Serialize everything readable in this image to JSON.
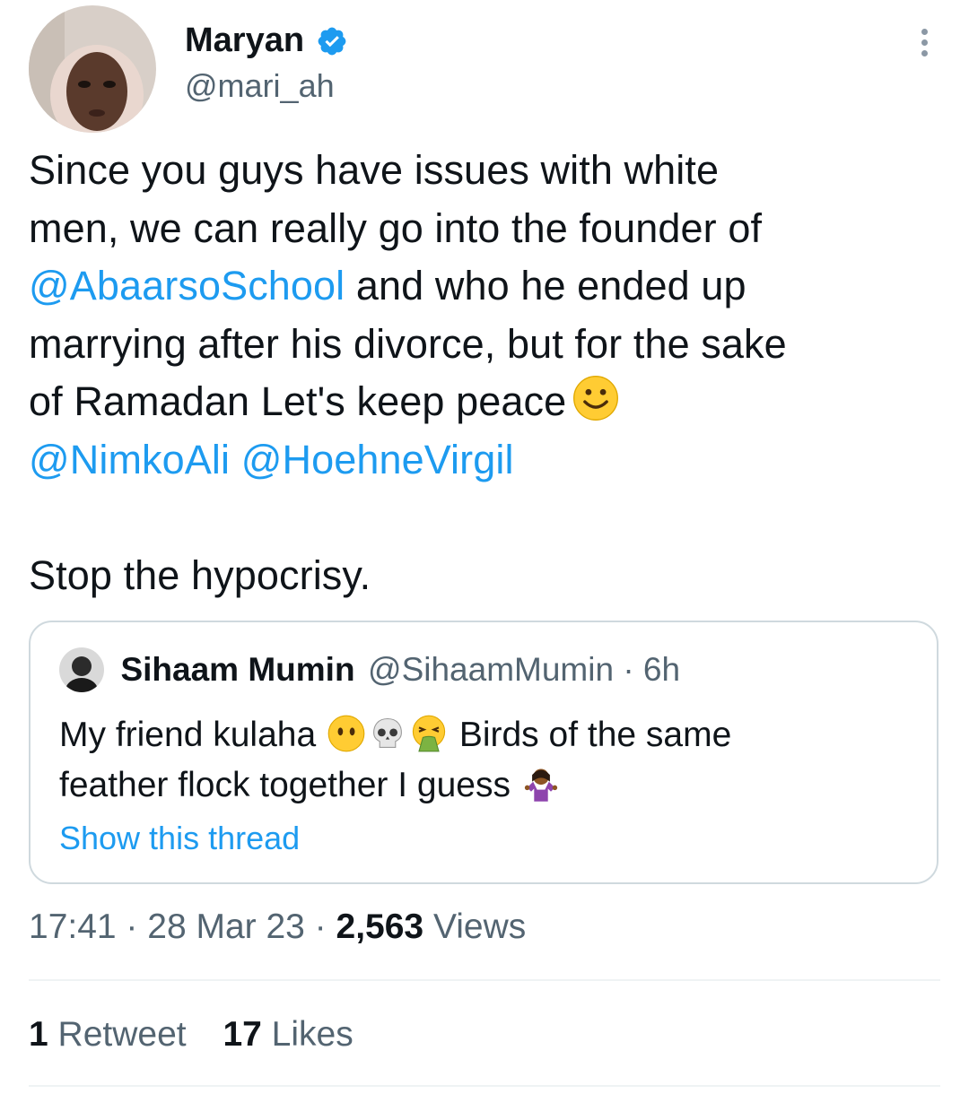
{
  "author": {
    "display_name": "Maryan",
    "handle": "@mari_ah",
    "verified": true,
    "avatar": "profile-photo"
  },
  "tweet": {
    "line1": "Since you guys have issues with white",
    "line2": "men, we can really go into the founder of",
    "mention_1": "@AbaarsoSchool",
    "line3_rest": " and who he ended up",
    "line4": "marrying after his divorce, but for the sake",
    "line5": "of Ramadan Let's keep peace",
    "mention_2": "@NimkoAli",
    "mention_3": "@HoehneVirgil",
    "closing": "Stop the hypocrisy."
  },
  "quoted": {
    "display_name": "Sihaam Mumin",
    "handle_time": "@SihaamMumin · 6h",
    "text_part1": "My friend kulaha",
    "text_part2": "Birds of the same",
    "text_line2": "feather flock together I guess",
    "show_thread": "Show this thread"
  },
  "meta": {
    "time_date": "17:41 · 28 Mar 23 · ",
    "views_count": "2,563",
    "views_label": " Views"
  },
  "stats": {
    "retweets_count": "1",
    "retweets_label": " Retweet",
    "likes_count": "17",
    "likes_label": " Likes"
  },
  "colors": {
    "accent": "#1d9bf0",
    "muted_text": "#536471",
    "text": "#0f1419",
    "border": "#cfd9de"
  },
  "icons": [
    "verified-badge-icon",
    "more-options-icon",
    "smiling-face-emoji",
    "dotted-eyes-face-emoji",
    "skull-emoji",
    "vomiting-face-emoji",
    "shrugging-woman-emoji"
  ]
}
